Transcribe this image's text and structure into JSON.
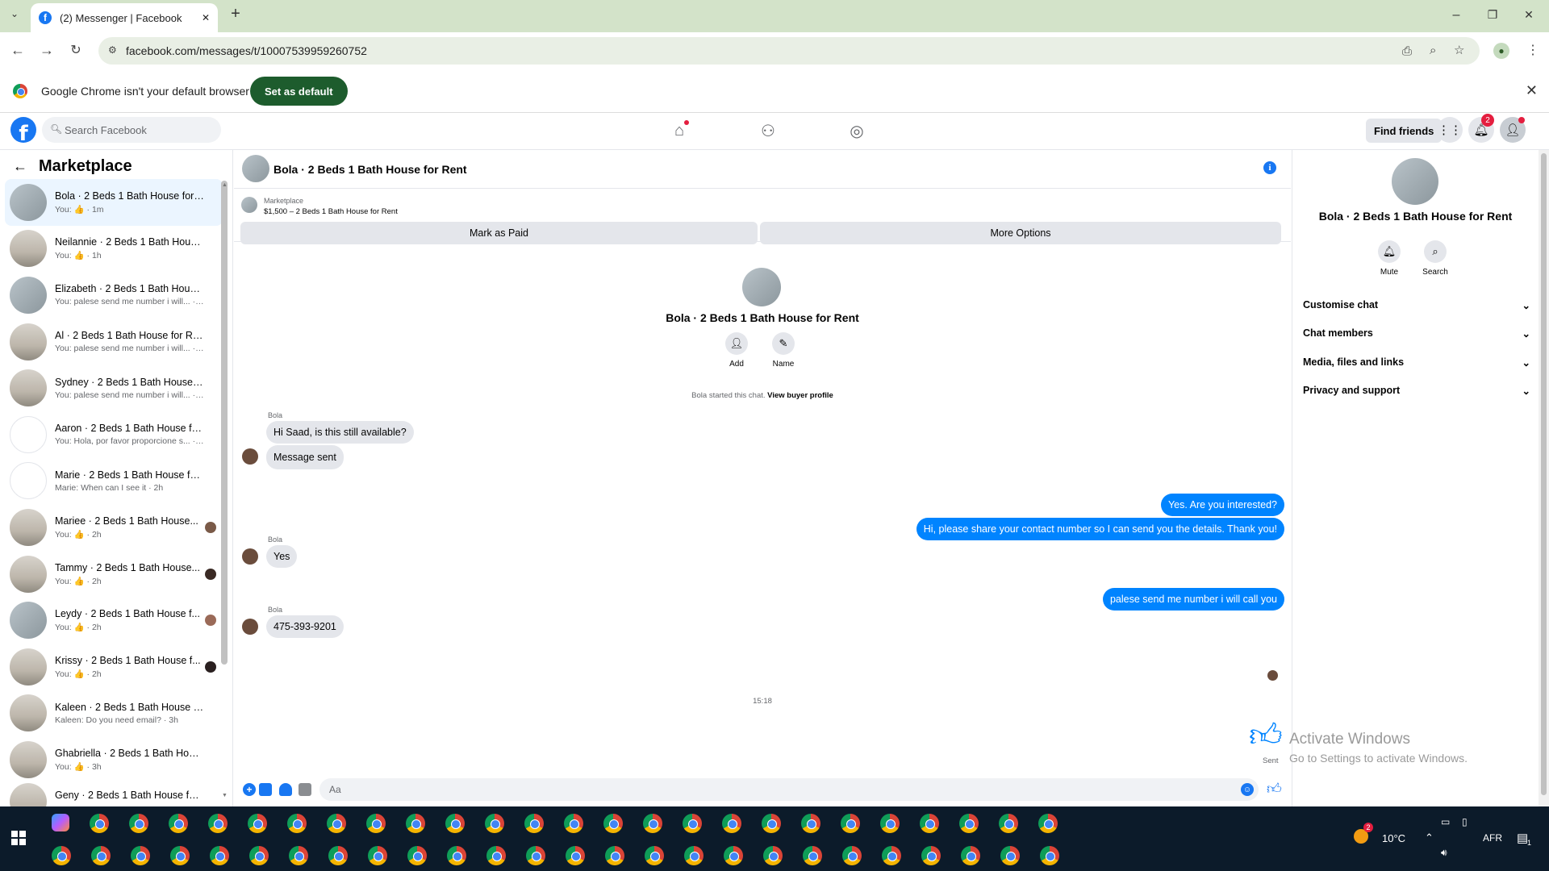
{
  "browser": {
    "tab_title": "(2) Messenger | Facebook",
    "new_tab": "+",
    "url": "facebook.com/messages/t/10007539959260752",
    "min": "–",
    "max": "❐",
    "close": "✕"
  },
  "infobar": {
    "message": "Google Chrome isn't your default browser",
    "button": "Set as default",
    "close": "✕"
  },
  "fb": {
    "search_placeholder": "Search Facebook",
    "find_friends": "Find friends",
    "notif_count": "2"
  },
  "left": {
    "title": "Marketplace",
    "conversations": [
      {
        "name": "Bola · 2 Beds 1 Bath House for ...",
        "sub": "You: 👍 · 1m"
      },
      {
        "name": "Neilannie · 2 Beds 1 Bath House...",
        "sub": "You: 👍 · 1h"
      },
      {
        "name": "Elizabeth · 2 Beds 1 Bath House...",
        "sub": "You: palese send me number i will... · 1h"
      },
      {
        "name": "Al · 2 Beds 1 Bath House for Rent",
        "sub": "You: palese send me number i will... · 1h"
      },
      {
        "name": "Sydney · 2 Beds 1 Bath House f...",
        "sub": "You: palese send me number i will... · 1h"
      },
      {
        "name": "Aaron · 2 Beds 1 Bath House for...",
        "sub": "You: Hola, por favor proporcione s... · 2h"
      },
      {
        "name": "Marie · 2 Beds 1 Bath House for...",
        "sub": "Marie: When can I see it · 2h"
      },
      {
        "name": "Mariee · 2 Beds 1 Bath House...",
        "sub": "You: 👍 · 2h"
      },
      {
        "name": "Tammy · 2 Beds 1 Bath House...",
        "sub": "You: 👍 · 2h"
      },
      {
        "name": "Leydy · 2 Beds 1 Bath House f...",
        "sub": "You: 👍 · 2h"
      },
      {
        "name": "Krissy · 2 Beds 1 Bath House f...",
        "sub": "You: 👍 · 2h"
      },
      {
        "name": "Kaleen · 2 Beds 1 Bath House fo...",
        "sub": "Kaleen: Do you need email? · 3h"
      },
      {
        "name": "Ghabriella · 2 Beds 1 Bath Hous...",
        "sub": "You: 👍 · 3h"
      },
      {
        "name": "Geny · 2 Beds 1 Bath House for ...",
        "sub": ""
      }
    ]
  },
  "chat": {
    "title": "Bola · 2 Beds 1 Bath House for Rent",
    "mp_label": "Marketplace",
    "mp_listing": "$1,500 – 2 Beds 1 Bath House for Rent",
    "mark_paid": "Mark as Paid",
    "more_options": "More Options",
    "intro_title": "Bola · 2 Beds 1 Bath House for Rent",
    "add": "Add",
    "name": "Name",
    "started": "Bola started this chat.",
    "view_profile": "View buyer profile",
    "sender": "Bola",
    "m1": "Hi Saad, is this still available?",
    "m2": "Message sent",
    "m3": "Yes. Are you interested?",
    "m4": "Hi, please share your contact number so I can send you the details. Thank you!",
    "m5": "Yes",
    "m6": "palese send me number i will call you",
    "m7": "475-393-9201",
    "time": "15:18",
    "sent": "Sent",
    "input_placeholder": "Aa"
  },
  "right": {
    "title": "Bola · 2 Beds 1 Bath House for Rent",
    "mute": "Mute",
    "search": "Search",
    "sections": [
      "Customise chat",
      "Chat members",
      "Media, files and links",
      "Privacy and support"
    ]
  },
  "watermark": {
    "line1": "Activate Windows",
    "line2": "Go to Settings to activate Windows."
  },
  "taskbar": {
    "temp": "10°C",
    "lang": "AFR",
    "weather_badge": "2",
    "notif": "1"
  }
}
